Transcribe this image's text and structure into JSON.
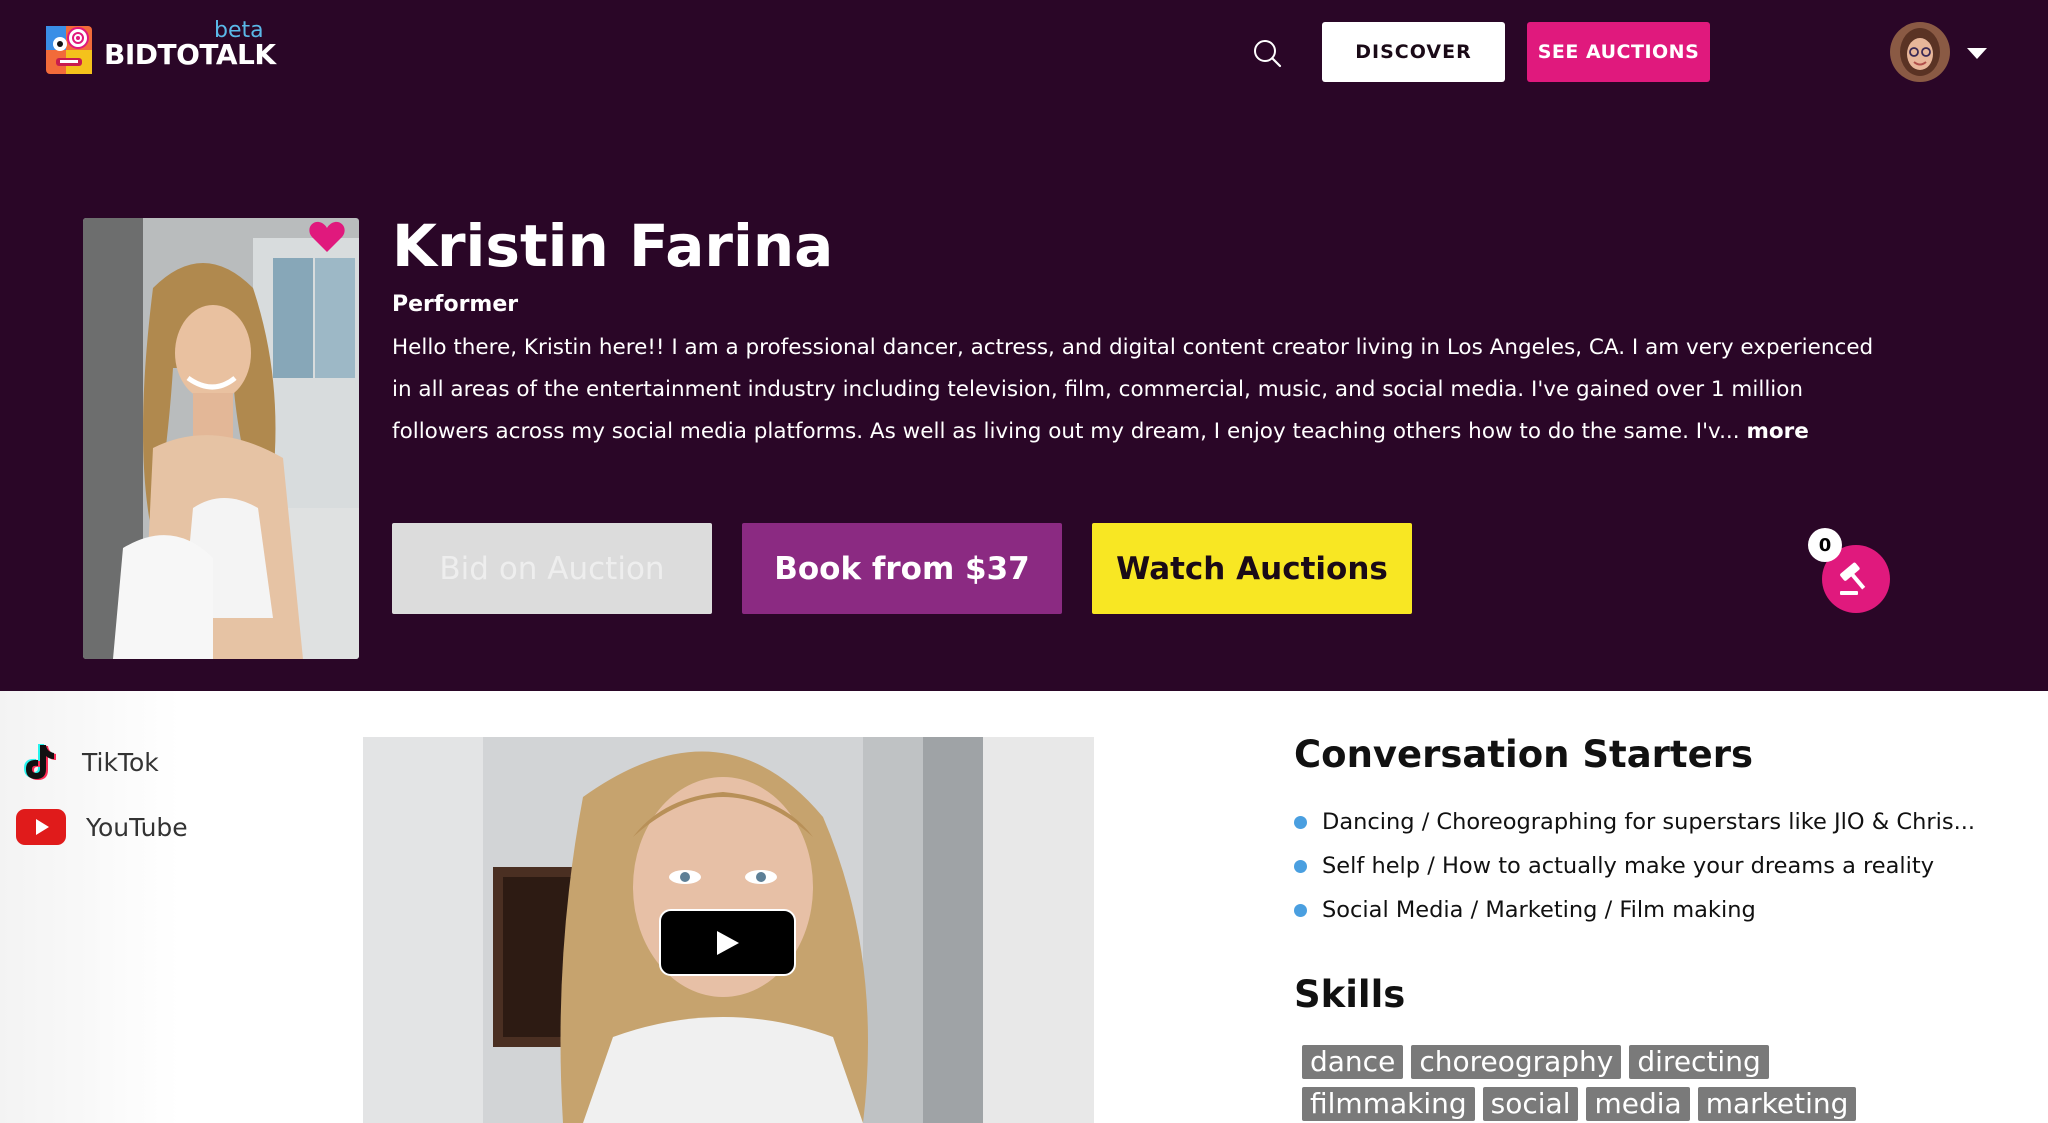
{
  "header": {
    "logo_text": "BIDTOTALK",
    "logo_badge": "beta",
    "discover_label": "DISCOVER",
    "see_auctions_label": "SEE AUCTIONS"
  },
  "profile": {
    "name": "Kristin Farina",
    "role": "Performer",
    "bio": "Hello there, Kristin here!! I am a professional dancer, actress, and digital content creator living in Los Angeles, CA. I am very experienced in all areas of the entertainment industry including television, film, commercial, music, and social media. I've gained over 1 million followers across my social media platforms. As well as living out my dream, I enjoy teaching others how to do the same. I'v...",
    "more_label": "more"
  },
  "actions": {
    "bid_label": "Bid on Auction",
    "book_label": "Book from $37",
    "watch_label": "Watch Auctions",
    "auction_count": "0"
  },
  "social": [
    {
      "label": "TikTok",
      "icon": "tiktok-icon"
    },
    {
      "label": "YouTube",
      "icon": "youtube-icon"
    }
  ],
  "conversation": {
    "title": "Conversation Starters",
    "items": [
      "Dancing / Choreographing for superstars like JlO & Chris...",
      "Self help / How to actually make your dreams a reality",
      "Social Media / Marketing / Film making"
    ]
  },
  "skills": {
    "title": "Skills",
    "items": [
      "dance",
      "choreography",
      "directing",
      "filmmaking",
      "social",
      "media",
      "marketing"
    ]
  },
  "colors": {
    "hero_bg": "#2a0627",
    "accent_pink": "#e0197d",
    "book_purple": "#8b2a82",
    "watch_yellow": "#f8e723",
    "bullet_blue": "#4a9fe0"
  }
}
